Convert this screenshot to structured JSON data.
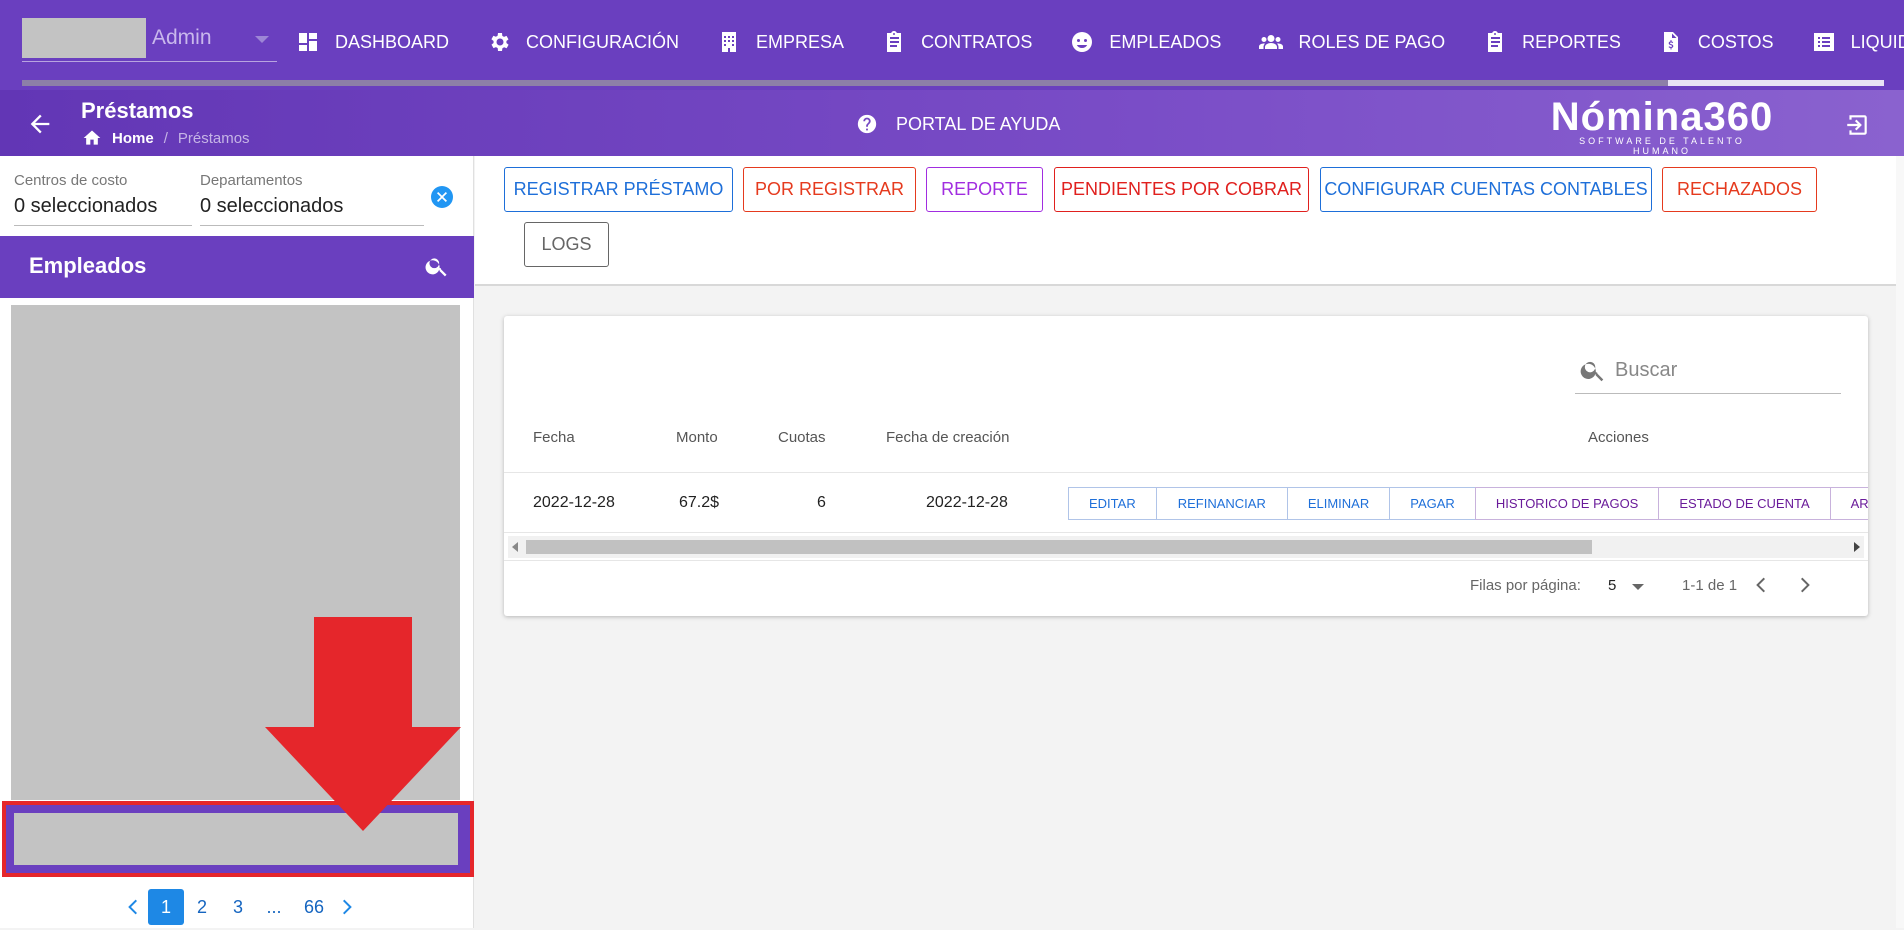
{
  "topnav": {
    "user_label": "Admin",
    "items": [
      {
        "label": "DASHBOARD",
        "icon": "dashboard-icon"
      },
      {
        "label": "CONFIGURACIÓN",
        "icon": "gear-icon"
      },
      {
        "label": "EMPRESA",
        "icon": "building-icon"
      },
      {
        "label": "CONTRATOS",
        "icon": "clipboard-icon"
      },
      {
        "label": "EMPLEADOS",
        "icon": "face-icon"
      },
      {
        "label": "ROLES DE PAGO",
        "icon": "users-icon"
      },
      {
        "label": "REPORTES",
        "icon": "clipboard-list-icon"
      },
      {
        "label": "COSTOS",
        "icon": "invoice-icon"
      },
      {
        "label": "LIQUIDACIONES",
        "icon": "list-icon"
      }
    ]
  },
  "subheader": {
    "title": "Préstamos",
    "breadcrumb_home": "Home",
    "breadcrumb_sep": "/",
    "breadcrumb_current": "Préstamos",
    "help_label": "PORTAL DE AYUDA",
    "brand_name": "Nómina360",
    "brand_tagline": "SOFTWARE DE TALENTO HUMANO"
  },
  "sidebar": {
    "filter_cost_label": "Centros de costo",
    "filter_cost_value": "0 seleccionados",
    "filter_dept_label": "Departamentos",
    "filter_dept_value": "0 seleccionados",
    "employees_title": "Empleados",
    "pagination": {
      "pages": [
        "1",
        "2",
        "3",
        "...",
        "66"
      ],
      "active": "1"
    }
  },
  "actions": {
    "buttons": [
      {
        "label": "REGISTRAR PRÉSTAMO",
        "color": "#1e6fd9"
      },
      {
        "label": "POR REGISTRAR",
        "color": "#e53a1e"
      },
      {
        "label": "REPORTE",
        "color": "#a12de0"
      },
      {
        "label": "PENDIENTES POR COBRAR",
        "color": "#e0201e"
      },
      {
        "label": "CONFIGURAR CUENTAS CONTABLES",
        "color": "#1e6fd9"
      },
      {
        "label": "RECHAZADOS",
        "color": "#e53a1e"
      },
      {
        "label": "LOGS",
        "color": "#666666"
      }
    ]
  },
  "table": {
    "search_placeholder": "Buscar",
    "headers": {
      "fecha": "Fecha",
      "monto": "Monto",
      "cuotas": "Cuotas",
      "creacion": "Fecha de creación",
      "acciones": "Acciones"
    },
    "rows": [
      {
        "fecha": "2022-12-28",
        "monto": "67.2$",
        "cuotas": "6",
        "creacion": "2022-12-28"
      }
    ],
    "row_actions": [
      {
        "label": "EDITAR",
        "color": "#1e6fd9"
      },
      {
        "label": "REFINANCIAR",
        "color": "#1e6fd9"
      },
      {
        "label": "ELIMINAR",
        "color": "#1e6fd9"
      },
      {
        "label": "PAGAR",
        "color": "#1e6fd9"
      },
      {
        "label": "HISTORICO DE PAGOS",
        "color": "#6a1b9a"
      },
      {
        "label": "ESTADO DE CUENTA",
        "color": "#6a1b9a"
      },
      {
        "label": "ARCHIVO BASE",
        "color": "#6a1b9a"
      }
    ],
    "rows_per_page_label": "Filas por página:",
    "rows_per_page_value": "5",
    "range_label": "1-1 de 1"
  },
  "colors": {
    "primary": "#6a3fbf",
    "highlight": "#e5262b"
  }
}
